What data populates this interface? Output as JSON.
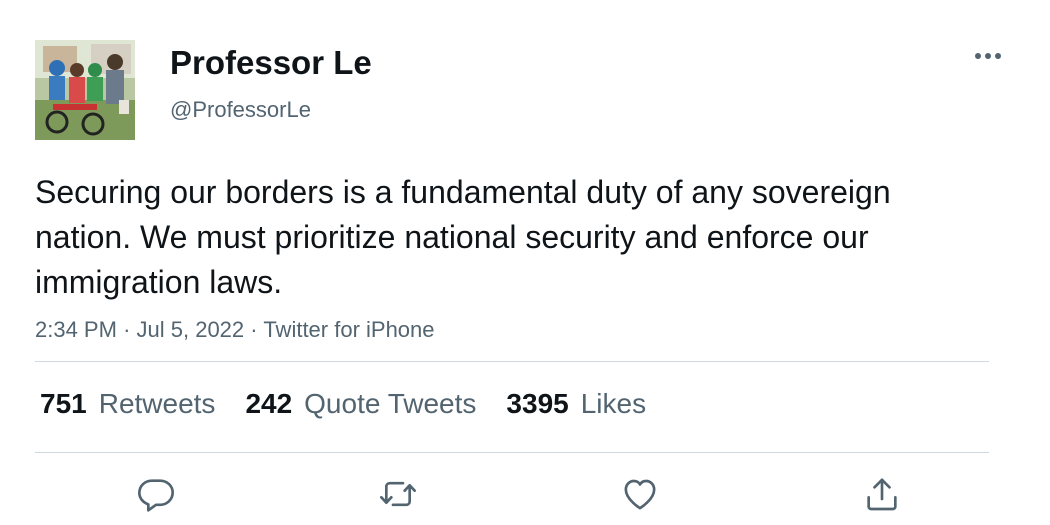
{
  "author": {
    "display_name": "Professor Le",
    "handle": "@ProfessorLe",
    "avatar": "family-photo-avatar"
  },
  "tweet": {
    "text": "Securing our borders is a fundamental duty of any sovereign nation. We must prioritize national security and enforce our immigration laws.",
    "time": "2:34 PM",
    "separator": "·",
    "date": "Jul 5, 2022",
    "source": "Twitter for iPhone"
  },
  "stats": {
    "retweets_count": "751",
    "retweets_label": "Retweets",
    "quotes_count": "242",
    "quotes_label": "Quote Tweets",
    "likes_count": "3395",
    "likes_label": "Likes"
  },
  "icons": {
    "more": "more-horizontal-icon",
    "reply": "reply-icon",
    "retweet": "retweet-icon",
    "like": "heart-icon",
    "share": "share-icon"
  },
  "colors": {
    "text_primary": "#0f1419",
    "text_secondary": "#536471",
    "divider": "#cfd9de"
  }
}
